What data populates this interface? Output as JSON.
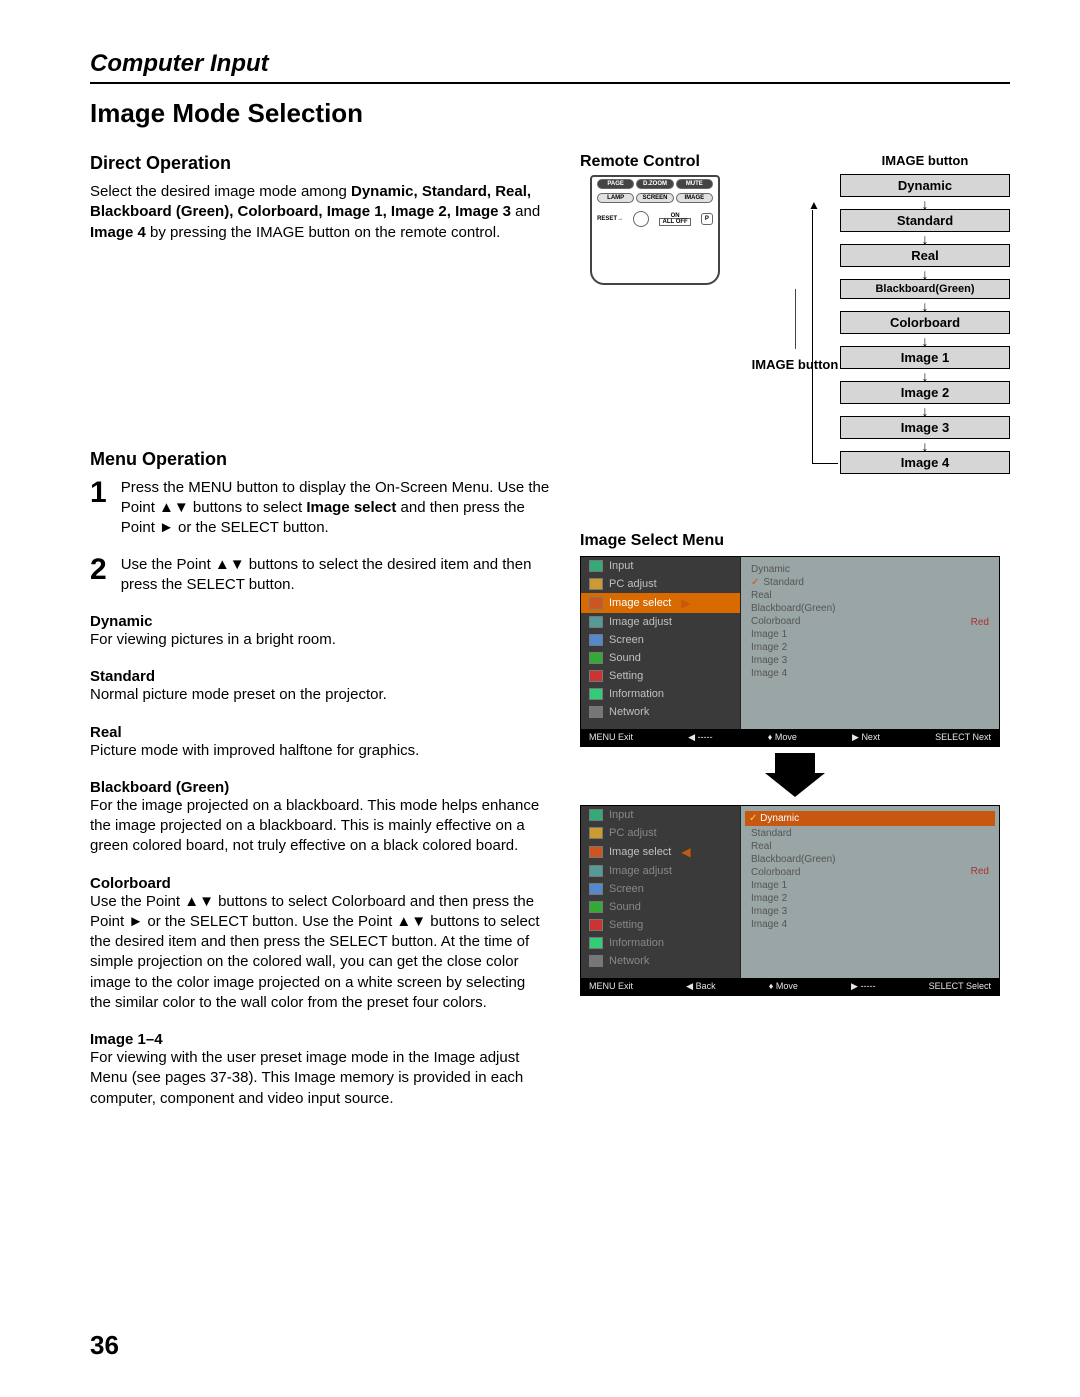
{
  "section_header": "Computer Input",
  "page_title": "Image Mode Selection",
  "direct_operation": {
    "heading": "Direct Operation",
    "text_prefix": "Select the desired image mode among ",
    "modes_bold": "Dynamic, Standard, Real, Blackboard (Green), Colorboard, Image 1, Image 2, Image 3",
    "and": " and ",
    "modes_tail": "Image 4",
    "text_suffix": " by pressing the IMAGE button on the remote control."
  },
  "menu_operation": {
    "heading": "Menu Operation",
    "steps": [
      {
        "num": "1",
        "text_a": "Press the MENU button to display the On-Screen Menu. Use the Point ▲▼ buttons to select ",
        "bold": "Image select",
        "text_b": " and then press the Point ► or the SELECT button."
      },
      {
        "num": "2",
        "text_a": "Use the Point ▲▼ buttons to select  the desired item and then press the SELECT button.",
        "bold": "",
        "text_b": ""
      }
    ]
  },
  "modes": [
    {
      "label": "Dynamic",
      "desc": "For viewing pictures in a bright room."
    },
    {
      "label": "Standard",
      "desc": "Normal picture mode preset on the projector."
    },
    {
      "label": "Real",
      "desc": "Picture mode with improved halftone for graphics."
    },
    {
      "label": "Blackboard (Green)",
      "desc": "For the image projected on a blackboard. This mode helps enhance the image projected on a blackboard. This is mainly effective on a green colored board, not truly effective on a black colored board."
    },
    {
      "label": "Colorboard",
      "desc": "Use the Point ▲▼ buttons to select Colorboard and then press the Point ► or the SELECT button. Use the Point ▲▼ buttons to select the desired item and then press the SELECT button. At the time of simple projection on the colored wall, you can get the close color image to the color image projected on a white screen by selecting the similar color to the wall color from the preset four colors."
    },
    {
      "label": "Image 1–4",
      "desc": "For viewing with the user preset image mode in the Image adjust Menu (see pages 37-38). This Image memory is provided in each computer, component and video input source."
    }
  ],
  "remote": {
    "heading": "Remote Control",
    "row1": [
      "PAGE",
      "D.ZOOM",
      "MUTE"
    ],
    "row2": [
      "LAMP",
      "SCREEN",
      "IMAGE"
    ],
    "reset": "RESET→",
    "on": "ON",
    "alloff": "ALL OFF",
    "p": "P",
    "pointer_label": "IMAGE button"
  },
  "flow": {
    "head": "IMAGE button",
    "items": [
      "Dynamic",
      "Standard",
      "Real",
      "Blackboard(Green)",
      "Colorboard",
      "Image 1",
      "Image 2",
      "Image 3",
      "Image 4"
    ]
  },
  "osd": {
    "heading": "Image Select Menu",
    "left_items": [
      "Input",
      "PC adjust",
      "Image select",
      "Image adjust",
      "Screen",
      "Sound",
      "Setting",
      "Information",
      "Network"
    ],
    "right_items": [
      "Dynamic",
      "Standard",
      "Real",
      "Blackboard(Green)",
      "Colorboard",
      "Image 1",
      "Image 2",
      "Image 3",
      "Image 4"
    ],
    "red": "Red",
    "bar1": {
      "exit": "MENU Exit",
      "back": "◀ -----",
      "move": "♦ Move",
      "next": "▶ Next",
      "select": "SELECT  Next"
    },
    "bar2": {
      "exit": "MENU Exit",
      "back": "◀ Back",
      "move": "♦ Move",
      "next": "▶ -----",
      "select": "SELECT  Select"
    }
  },
  "page_num": "36"
}
